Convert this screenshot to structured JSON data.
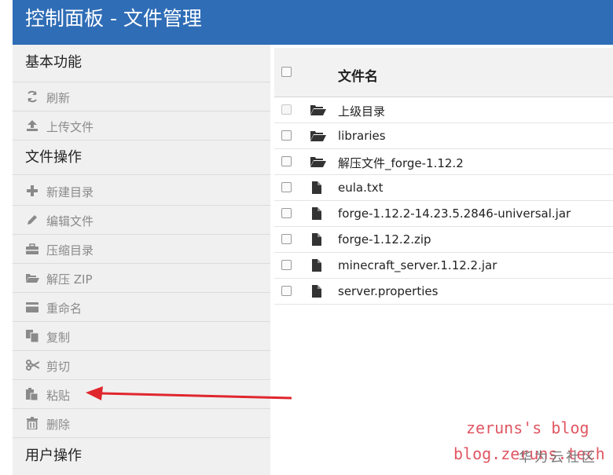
{
  "header": {
    "title": "控制面板 - 文件管理"
  },
  "sidebar": {
    "sections": [
      {
        "title": "基本功能",
        "items": [
          {
            "label": "刷新",
            "icon": "refresh-icon"
          },
          {
            "label": "上传文件",
            "icon": "upload-icon"
          }
        ]
      },
      {
        "title": "文件操作",
        "items": [
          {
            "label": "新建目录",
            "icon": "plus-icon"
          },
          {
            "label": "编辑文件",
            "icon": "pencil-icon"
          },
          {
            "label": "压缩目录",
            "icon": "briefcase-icon"
          },
          {
            "label": "解压 ZIP",
            "icon": "folder-open-icon"
          },
          {
            "label": "重命名",
            "icon": "credit-card-icon"
          },
          {
            "label": "复制",
            "icon": "copy-icon"
          },
          {
            "label": "剪切",
            "icon": "scissors-icon"
          },
          {
            "label": "粘贴",
            "icon": "paste-icon"
          },
          {
            "label": "删除",
            "icon": "trash-icon"
          }
        ]
      },
      {
        "title": "用户操作",
        "items": []
      }
    ]
  },
  "files": {
    "column_name": "文件名",
    "rows": [
      {
        "name": "上级目录",
        "type": "folder"
      },
      {
        "name": "libraries",
        "type": "folder"
      },
      {
        "name": "解压文件_forge-1.12.2",
        "type": "folder"
      },
      {
        "name": "eula.txt",
        "type": "file"
      },
      {
        "name": "forge-1.12.2-14.23.5.2846-universal.jar",
        "type": "file"
      },
      {
        "name": "forge-1.12.2.zip",
        "type": "file"
      },
      {
        "name": "minecraft_server.1.12.2.jar",
        "type": "file"
      },
      {
        "name": "server.properties",
        "type": "file"
      }
    ]
  },
  "watermark": {
    "line1": "zeruns's blog",
    "line2": "blog.zeruns.tech",
    "line3": "华为云社区"
  },
  "colors": {
    "header_bg": "#2f6db6",
    "sidebar_bg": "#f0f0f0",
    "annotation_arrow": "#e0262d",
    "watermark": "#e05763"
  }
}
